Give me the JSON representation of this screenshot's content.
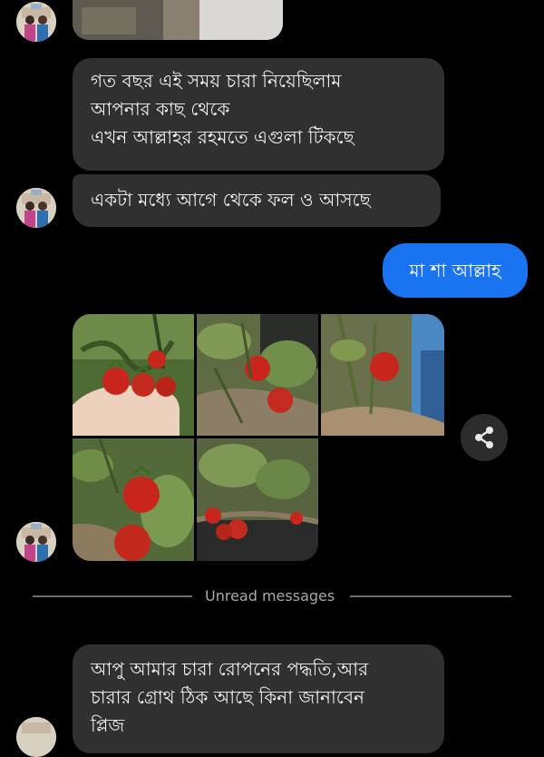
{
  "messages": {
    "m1": {
      "lines": [
        "গত বছর এই সময় চারা নিয়েছিলাম",
        "আপনার কাছ থেকে",
        "এখন আল্লাহর রহমতে এগুলা টিকছে"
      ]
    },
    "m2": {
      "text": "একটা মধ্যে আগে থেকে ফল ও আসছে"
    },
    "m3": {
      "text": "মা শা আল্লাহ"
    },
    "m4": {
      "lines": [
        "আপু আমার চারা রোপনের পদ্ধতি,আর",
        "চারার গ্রোথ  ঠিক আছে কিনা জানাবেন",
        "প্লিজ"
      ]
    }
  },
  "divider": {
    "label": "Unread messages"
  },
  "icons": {
    "share": "share-icon",
    "avatar": "contact-avatar"
  },
  "colors": {
    "background": "#000000",
    "incoming_bubble": "#303030",
    "outgoing_bubble": "#1a73f0",
    "divider": "#6e6e6e",
    "strawberry": "#c8261c"
  },
  "photo_grid": {
    "count": 5,
    "photos": [
      {
        "name": "strawberries-in-hand-photo"
      },
      {
        "name": "strawberry-plant-photo-2"
      },
      {
        "name": "strawberry-plant-photo-3"
      },
      {
        "name": "strawberry-plant-photo-4"
      },
      {
        "name": "strawberry-pot-photo-5"
      }
    ]
  }
}
